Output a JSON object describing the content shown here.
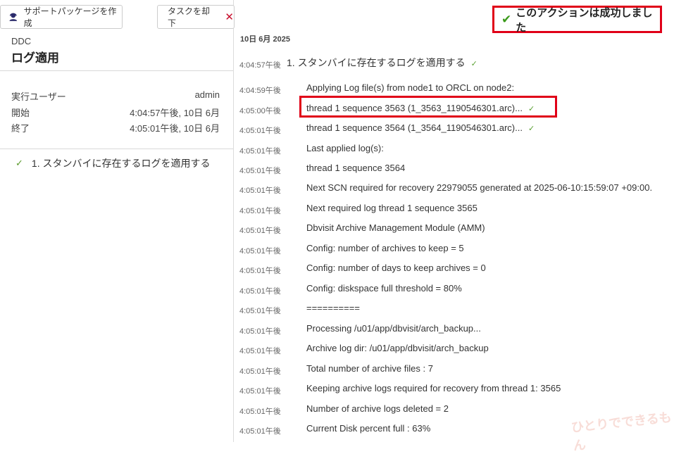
{
  "sidebar": {
    "support_button": "サポートパッケージを作成",
    "withdraw_button": "タスクを却下",
    "subtitle": "DDC",
    "title": "ログ適用",
    "info": [
      {
        "label": "実行ユーザー",
        "value": "admin"
      },
      {
        "label": "開始",
        "value": "4:04:57午後, 10日 6月"
      },
      {
        "label": "終了",
        "value": "4:05:01午後, 10日 6月"
      }
    ],
    "step": "1. スタンバイに存在するログを適用する"
  },
  "banner": "このアクションは成功しました",
  "date": "10日 6月 2025",
  "logs": [
    {
      "time": "4:04:57午後",
      "msg": "1. スタンバイに存在するログを適用する",
      "ok": true
    },
    {
      "time": "4:04:59午後",
      "msg": "Applying Log file(s) from node1 to ORCL on node2:"
    },
    {
      "time": "4:05:00午後",
      "msg": "thread 1 sequence 3563 (1_3563_1190546301.arc)...",
      "ok": true
    },
    {
      "time": "4:05:01午後",
      "msg": "thread 1 sequence 3564 (1_3564_1190546301.arc)...",
      "ok": true
    },
    {
      "time": "4:05:01午後",
      "msg": "Last applied log(s):"
    },
    {
      "time": "4:05:01午後",
      "msg": "thread 1 sequence 3564"
    },
    {
      "time": "4:05:01午後",
      "msg": "Next SCN required for recovery 22979055 generated at 2025-06-10:15:59:07 +09:00."
    },
    {
      "time": "4:05:01午後",
      "msg": "Next required log thread 1 sequence 3565"
    },
    {
      "time": "4:05:01午後",
      "msg": "Dbvisit Archive Management Module (AMM)"
    },
    {
      "time": "4:05:01午後",
      "msg": "Config: number of archives to keep = 5"
    },
    {
      "time": "4:05:01午後",
      "msg": "Config: number of days to keep archives = 0"
    },
    {
      "time": "4:05:01午後",
      "msg": "Config: diskspace full threshold = 80%"
    },
    {
      "time": "4:05:01午後",
      "msg": "=========="
    },
    {
      "time": "4:05:01午後",
      "msg": "Processing /u01/app/dbvisit/arch_backup..."
    },
    {
      "time": "4:05:01午後",
      "msg": "Archive log dir: /u01/app/dbvisit/arch_backup"
    },
    {
      "time": "4:05:01午後",
      "msg": "Total number of archive files : 7"
    },
    {
      "time": "4:05:01午後",
      "msg": "Keeping archive logs required for recovery from thread 1: 3565"
    },
    {
      "time": "4:05:01午後",
      "msg": "Number of archive logs deleted = 2"
    },
    {
      "time": "4:05:01午後",
      "msg": "Current Disk percent full : 63%"
    }
  ],
  "watermark": "ひとりでできるもん",
  "colors": {
    "highlight": "#e00018",
    "success": "#3a9a1a",
    "withdraw": "#c8102e"
  }
}
